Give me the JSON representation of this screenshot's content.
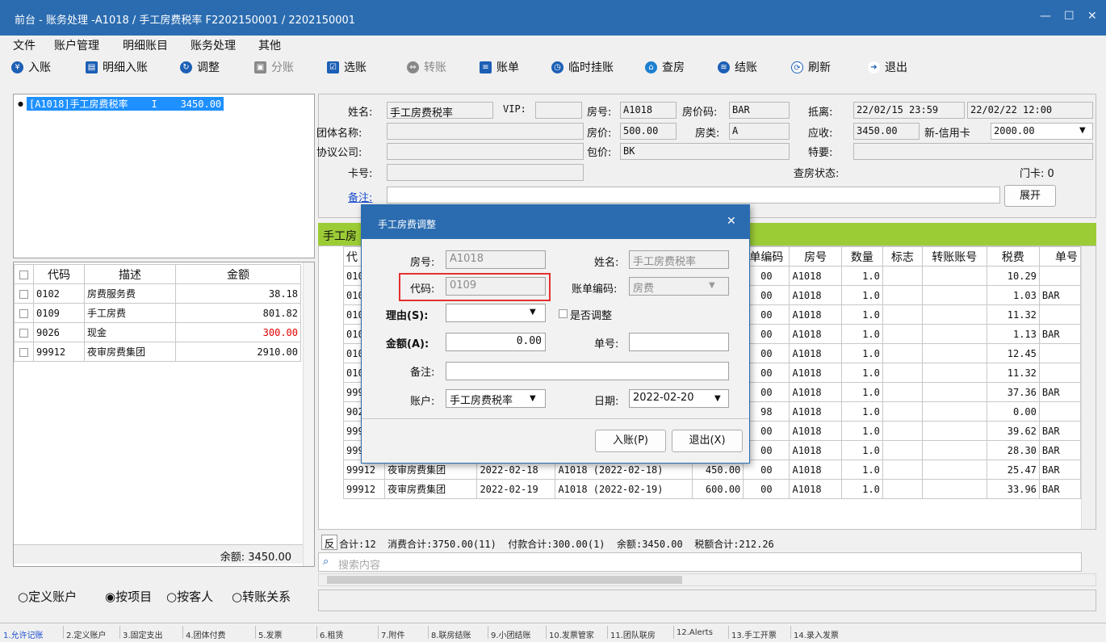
{
  "window": {
    "title": "前台 - 账务处理 -A1018 / 手工房费税率 F2202150001 / 2202150001",
    "min": "—",
    "max": "☐",
    "close": "✕"
  },
  "menu": [
    "文件",
    "账户管理",
    "明细账目",
    "账务处理",
    "其他"
  ],
  "toolbar": [
    {
      "label": "入账",
      "icon": "¥"
    },
    {
      "label": "明细入账",
      "icon": "▤"
    },
    {
      "label": "调整",
      "icon": "↻"
    },
    {
      "label": "分账",
      "icon": "▣"
    },
    {
      "label": "选账",
      "icon": "☑"
    },
    {
      "label": "转账",
      "icon": "⇔"
    },
    {
      "label": "账单",
      "icon": "≡"
    },
    {
      "label": "临时挂账",
      "icon": "◷"
    },
    {
      "label": "查房",
      "icon": "⌂"
    },
    {
      "label": "结账",
      "icon": "≋"
    },
    {
      "label": "刷新",
      "icon": "⟳"
    },
    {
      "label": "退出",
      "icon": "➜"
    }
  ],
  "accounts_list": {
    "item": "[A1018]手工房费税率    I    3450.00"
  },
  "left_table": {
    "headers": [
      "代码",
      "描述",
      "金额"
    ],
    "rows": [
      {
        "code": "0102",
        "desc": "房费服务费",
        "amount": "38.18"
      },
      {
        "code": "0109",
        "desc": "手工房费",
        "amount": "801.82"
      },
      {
        "code": "9026",
        "desc": "现金",
        "amount": "300.00"
      },
      {
        "code": "99912",
        "desc": "夜审房费集团",
        "amount": "2910.00"
      }
    ],
    "balance": "余额: 3450.00"
  },
  "view_options": [
    "○定义账户",
    "◉按项目",
    "○按客人",
    "○转账关系"
  ],
  "guest": {
    "name_label": "姓名:",
    "name": "手工房费税率",
    "vip_label": "VIP:",
    "vip": "",
    "room_label": "房号:",
    "room": "A1018",
    "rate_code_label": "房价码:",
    "rate_code": "BAR",
    "arrive_label": "抵离:",
    "arrive": "22/02/15 23:59",
    "depart": "22/02/22 12:00",
    "group_label": "团体名称:",
    "group": "",
    "rate_label": "房价:",
    "rate": "500.00",
    "room_type_label": "房类:",
    "room_type": "A",
    "due_label": "应收:",
    "due": "3450.00",
    "credit_label": "新-信用卡",
    "credit": "2000.00",
    "company_label": "协议公司:",
    "company": "",
    "package_label": "包价:",
    "package": "BK",
    "special_label": "特要:",
    "special": "",
    "card_label": "卡号:",
    "card": "",
    "inspect_label": "查房状态:",
    "door_card": "门卡: 0",
    "remark_link": "备注:",
    "remark": "",
    "expand": "展开"
  },
  "tab_strip": "手工房",
  "detail_table": {
    "headers": [
      "代",
      "",
      "",
      "",
      "",
      "单编码",
      "房号",
      "数量",
      "标志",
      "转账账号",
      "税费",
      "单号"
    ],
    "rows": [
      {
        "c": "010",
        "d": "",
        "date": "",
        "desc": "",
        "amt": "",
        "bill": "00",
        "room": "A1018",
        "qty": "1.0",
        "tax": "10.29",
        "no": ""
      },
      {
        "c": "010",
        "d": "",
        "date": "",
        "desc": "",
        "amt": "",
        "bill": "00",
        "room": "A1018",
        "qty": "1.0",
        "tax": "1.03",
        "no": "BAR"
      },
      {
        "c": "010",
        "d": "",
        "date": "",
        "desc": "",
        "amt": "",
        "bill": "00",
        "room": "A1018",
        "qty": "1.0",
        "tax": "11.32",
        "no": ""
      },
      {
        "c": "010",
        "d": "",
        "date": "",
        "desc": "",
        "amt": "",
        "bill": "00",
        "room": "A1018",
        "qty": "1.0",
        "tax": "1.13",
        "no": "BAR"
      },
      {
        "c": "010",
        "d": "",
        "date": "",
        "desc": "",
        "amt": "",
        "bill": "00",
        "room": "A1018",
        "qty": "1.0",
        "tax": "12.45",
        "no": ""
      },
      {
        "c": "010",
        "d": "",
        "date": "",
        "desc": "",
        "amt": "",
        "bill": "00",
        "room": "A1018",
        "qty": "1.0",
        "tax": "11.32",
        "no": ""
      },
      {
        "c": "999",
        "d": "",
        "date": "",
        "desc": "",
        "amt": "",
        "bill": "00",
        "room": "A1018",
        "qty": "1.0",
        "tax": "37.36",
        "no": "BAR"
      },
      {
        "c": "902",
        "d": "",
        "date": "",
        "desc": "",
        "amt": "",
        "bill": "98",
        "room": "A1018",
        "qty": "1.0",
        "tax": "0.00",
        "no": ""
      },
      {
        "c": "999",
        "d": "",
        "date": "",
        "desc": "",
        "amt": "",
        "bill": "00",
        "room": "A1018",
        "qty": "1.0",
        "tax": "39.62",
        "no": "BAR"
      },
      {
        "c": "999",
        "d": "",
        "date": "",
        "desc": "",
        "amt": "",
        "bill": "00",
        "room": "A1018",
        "qty": "1.0",
        "tax": "28.30",
        "no": "BAR"
      },
      {
        "c": "99912",
        "d": "夜审房费集团",
        "date": "2022-02-18",
        "desc": "A1018 (2022-02-18)",
        "amt": "450.00",
        "bill": "00",
        "room": "A1018",
        "qty": "1.0",
        "tax": "25.47",
        "no": "BAR"
      },
      {
        "c": "99912",
        "d": "夜审房费集团",
        "date": "2022-02-19",
        "desc": "A1018 (2022-02-19)",
        "amt": "600.00",
        "bill": "00",
        "room": "A1018",
        "qty": "1.0",
        "tax": "33.96",
        "no": "BAR"
      }
    ]
  },
  "summary": {
    "reverse": "反",
    "text": "合计:12  消费合计:3750.00(11)  付款合计:300.00(1)  余额:3450.00  税额合计:212.26"
  },
  "search": {
    "placeholder": "搜索内容"
  },
  "dialog": {
    "title": "手工房费调整",
    "close": "✕",
    "room_label": "房号:",
    "room": "A1018",
    "name_label": "姓名:",
    "name": "手工房费税率",
    "code_label": "代码:",
    "code": "0109",
    "bill_code_label": "账单编码:",
    "bill_code": "房费",
    "reason_label": "理由(S):",
    "reason": "",
    "adjust_label": "是否调整",
    "amount_label": "金额(A):",
    "amount": "0.00",
    "number_label": "单号:",
    "number": "",
    "remark_label": "备注:",
    "remark": "",
    "account_label": "账户:",
    "account": "手工房费税率",
    "date_label": "日期:",
    "date": "2022-02-20",
    "post_button": "入账(P)",
    "exit_button": "退出(X)"
  },
  "bottom_tabs": [
    "1.允许记账",
    "2.定义账户",
    "3.固定支出",
    "4.团体付费",
    "5.发票",
    "6.租赁",
    "7.附件",
    "8.联房结账",
    "9.小团结账",
    "10.发票管家",
    "11.团队联房",
    "12.Alerts",
    "13.手工开票",
    "14.录入发票"
  ]
}
